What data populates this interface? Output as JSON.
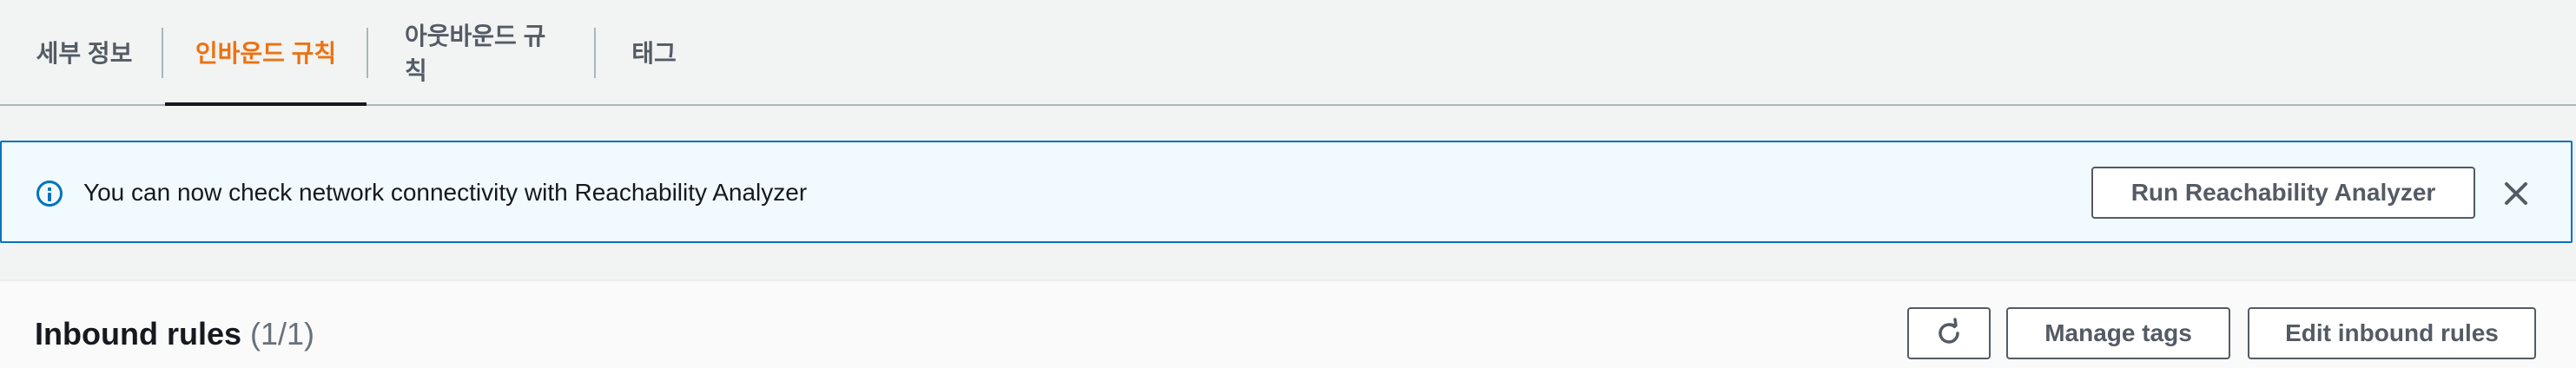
{
  "tabs": [
    {
      "label": "세부 정보",
      "active": false
    },
    {
      "label": "인바운드 규칙",
      "active": true
    },
    {
      "label": "아웃바운드 규칙",
      "active": false
    },
    {
      "label": "태그",
      "active": false
    }
  ],
  "banner": {
    "icon": "info-icon",
    "message": "You can now check network connectivity with Reachability Analyzer",
    "action_label": "Run Reachability Analyzer",
    "dismiss_icon": "close-icon"
  },
  "inbound": {
    "title": "Inbound rules",
    "count": "(1/1)",
    "refresh_icon": "refresh-icon",
    "manage_tags_label": "Manage tags",
    "edit_label": "Edit inbound rules"
  },
  "colors": {
    "active_tab": "#ec7211",
    "info_blue": "#0073bb",
    "banner_bg": "#f1faff",
    "button_border": "#545b64"
  }
}
